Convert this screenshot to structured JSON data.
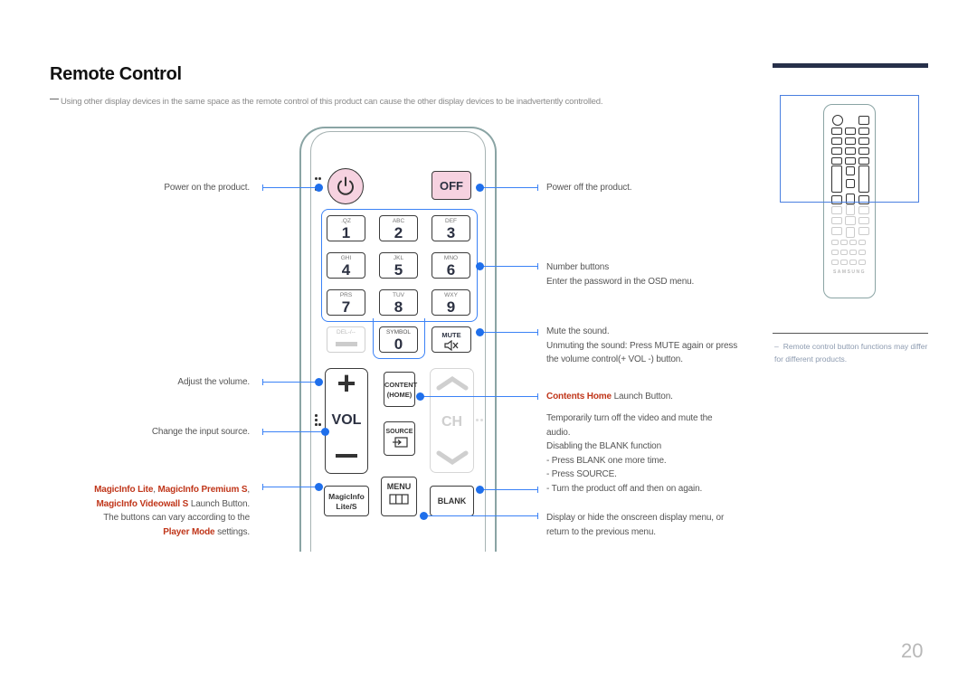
{
  "page": {
    "title": "Remote Control",
    "note": "Using other display devices in the same space as the remote control of this product can cause the other display devices to be inadvertently controlled.",
    "side_note": "Remote control button functions may differ for different products.",
    "side_note_dash": "–",
    "page_number": "20"
  },
  "colors": {
    "accent_blue": "#3b82f6",
    "highlight_red": "#c0361a",
    "header_bar": "#27304a",
    "power_key_fill": "#f6d2e0"
  },
  "remote": {
    "power_icon": "⏻",
    "off_label": "OFF",
    "number_keys": [
      {
        "sub": ".QZ",
        "num": "1"
      },
      {
        "sub": "ABC",
        "num": "2"
      },
      {
        "sub": "DEF",
        "num": "3"
      },
      {
        "sub": "GHI",
        "num": "4"
      },
      {
        "sub": "JKL",
        "num": "5"
      },
      {
        "sub": "MNO",
        "num": "6"
      },
      {
        "sub": "PRS",
        "num": "7"
      },
      {
        "sub": "TUV",
        "num": "8"
      },
      {
        "sub": "WXY",
        "num": "9"
      }
    ],
    "del_label": "DEL-/--",
    "symbol_label": "SYMBOL",
    "zero_label": "0",
    "mute_label": "MUTE",
    "mute_icon": "🔇",
    "vol_plus": "+",
    "vol_label": "VOL",
    "vol_minus": "−",
    "content_label_1": "CONTENT",
    "content_label_2": "(HOME)",
    "source_label": "SOURCE",
    "ch_label": "CH",
    "magicinfo_label_1": "MagicInfo",
    "magicinfo_label_2": "Lite/S",
    "menu_label": "MENU",
    "blank_label": "BLANK"
  },
  "left_labels": {
    "power_on": "Power on the product.",
    "volume": "Adjust the volume.",
    "source": "Change the input source.",
    "magicinfo": {
      "m1": "MagicInfo Lite",
      "sep1": ", ",
      "m2": "MagicInfo Premium S",
      "sep2": ",",
      "m3": "MagicInfo Videowall S",
      "rest1": " Launch Button.",
      "line3": "The buttons can vary according to the",
      "player_mode": "Player Mode",
      "rest2": " settings."
    }
  },
  "right_labels": {
    "power_off": "Power off the product.",
    "number_title": "Number buttons",
    "number_desc": "Enter the password in the OSD menu.",
    "mute_title": "Mute the sound.",
    "mute_desc_1": "Unmuting the sound: Press MUTE again or press",
    "mute_desc_2": "the volume control(+ VOL -) button.",
    "contents_home": "Contents Home",
    "contents_rest": " Launch Button.",
    "blank_1": "Temporarily turn off the video and mute the",
    "blank_2": "audio.",
    "blank_3": "Disabling the BLANK function",
    "blank_4": "- Press BLANK one more time.",
    "blank_5": "- Press SOURCE.",
    "blank_6": "- Turn the product off and then on again.",
    "menu_1": "Display or hide the onscreen display menu, or",
    "menu_2": "return to the previous menu."
  },
  "thumbnail": {
    "brand": "SAMSUNG"
  }
}
